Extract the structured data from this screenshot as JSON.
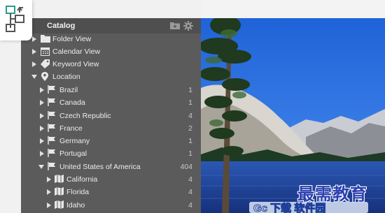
{
  "panel": {
    "title": "Catalog",
    "items": [
      {
        "label": "Folder View",
        "icon": "folder-icon",
        "expand": "right",
        "count": ""
      },
      {
        "label": "Calendar View",
        "icon": "calendar-icon",
        "expand": "right",
        "count": ""
      },
      {
        "label": "Keyword View",
        "icon": "tag-icon",
        "expand": "right",
        "count": ""
      },
      {
        "label": "Location",
        "icon": "location-pin-icon",
        "expand": "down",
        "count": ""
      },
      {
        "label": "Brazil",
        "icon": "flag-icon",
        "expand": "right",
        "count": "1"
      },
      {
        "label": "Canada",
        "icon": "flag-icon",
        "expand": "right",
        "count": "1"
      },
      {
        "label": "Czech Republic",
        "icon": "flag-icon",
        "expand": "right",
        "count": "4"
      },
      {
        "label": "France",
        "icon": "flag-icon",
        "expand": "right",
        "count": "2"
      },
      {
        "label": "Germany",
        "icon": "flag-icon",
        "expand": "right",
        "count": "1"
      },
      {
        "label": "Portugal",
        "icon": "flag-icon",
        "expand": "right",
        "count": "1"
      },
      {
        "label": "United States of America",
        "icon": "flag-icon",
        "expand": "down",
        "count": "404"
      },
      {
        "label": "California",
        "icon": "map-icon",
        "expand": "right",
        "count": "4"
      },
      {
        "label": "Florida",
        "icon": "map-icon",
        "expand": "right",
        "count": "4"
      },
      {
        "label": "Idaho",
        "icon": "map-icon",
        "expand": "right",
        "count": "4"
      }
    ]
  },
  "watermark": {
    "text": "最需教育",
    "logo_text": "Gc 下载 软件园"
  },
  "colors": {
    "panel_bg": "#5b5b5b",
    "header_bg": "#4f4f4f",
    "watermark_blue": "#2a3fb0"
  }
}
